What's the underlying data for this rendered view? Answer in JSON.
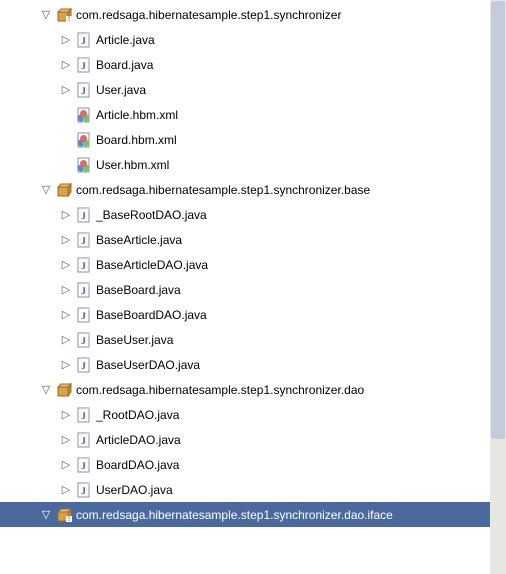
{
  "nodes": [
    {
      "indent": 2,
      "expand": "expanded",
      "icon": "package-warn",
      "label": "com.redsaga.hibernatesample.step1.synchronizer",
      "selected": false
    },
    {
      "indent": 3,
      "expand": "collapsed",
      "icon": "java-file",
      "label": "Article.java",
      "selected": false
    },
    {
      "indent": 3,
      "expand": "collapsed",
      "icon": "java-file",
      "label": "Board.java",
      "selected": false
    },
    {
      "indent": 3,
      "expand": "collapsed",
      "icon": "java-file",
      "label": "User.java",
      "selected": false
    },
    {
      "indent": 3,
      "expand": "none",
      "icon": "xml-file",
      "label": "Article.hbm.xml",
      "selected": false
    },
    {
      "indent": 3,
      "expand": "none",
      "icon": "xml-file",
      "label": "Board.hbm.xml",
      "selected": false
    },
    {
      "indent": 3,
      "expand": "none",
      "icon": "xml-file",
      "label": "User.hbm.xml",
      "selected": false
    },
    {
      "indent": 2,
      "expand": "expanded",
      "icon": "package",
      "label": "com.redsaga.hibernatesample.step1.synchronizer.base",
      "selected": false
    },
    {
      "indent": 3,
      "expand": "collapsed",
      "icon": "java-file",
      "label": "_BaseRootDAO.java",
      "selected": false
    },
    {
      "indent": 3,
      "expand": "collapsed",
      "icon": "java-file",
      "label": "BaseArticle.java",
      "selected": false
    },
    {
      "indent": 3,
      "expand": "collapsed",
      "icon": "java-file",
      "label": "BaseArticleDAO.java",
      "selected": false
    },
    {
      "indent": 3,
      "expand": "collapsed",
      "icon": "java-file",
      "label": "BaseBoard.java",
      "selected": false
    },
    {
      "indent": 3,
      "expand": "collapsed",
      "icon": "java-file",
      "label": "BaseBoardDAO.java",
      "selected": false
    },
    {
      "indent": 3,
      "expand": "collapsed",
      "icon": "java-file",
      "label": "BaseUser.java",
      "selected": false
    },
    {
      "indent": 3,
      "expand": "collapsed",
      "icon": "java-file",
      "label": "BaseUserDAO.java",
      "selected": false
    },
    {
      "indent": 2,
      "expand": "expanded",
      "icon": "package",
      "label": "com.redsaga.hibernatesample.step1.synchronizer.dao",
      "selected": false
    },
    {
      "indent": 3,
      "expand": "collapsed",
      "icon": "java-file",
      "label": "_RootDAO.java",
      "selected": false
    },
    {
      "indent": 3,
      "expand": "collapsed",
      "icon": "java-file",
      "label": "ArticleDAO.java",
      "selected": false
    },
    {
      "indent": 3,
      "expand": "collapsed",
      "icon": "java-file",
      "label": "BoardDAO.java",
      "selected": false
    },
    {
      "indent": 3,
      "expand": "collapsed",
      "icon": "java-file",
      "label": "UserDAO.java",
      "selected": false
    },
    {
      "indent": 2,
      "expand": "expanded",
      "icon": "package-warn",
      "label": "com.redsaga.hibernatesample.step1.synchronizer.dao.iface",
      "selected": true
    }
  ]
}
